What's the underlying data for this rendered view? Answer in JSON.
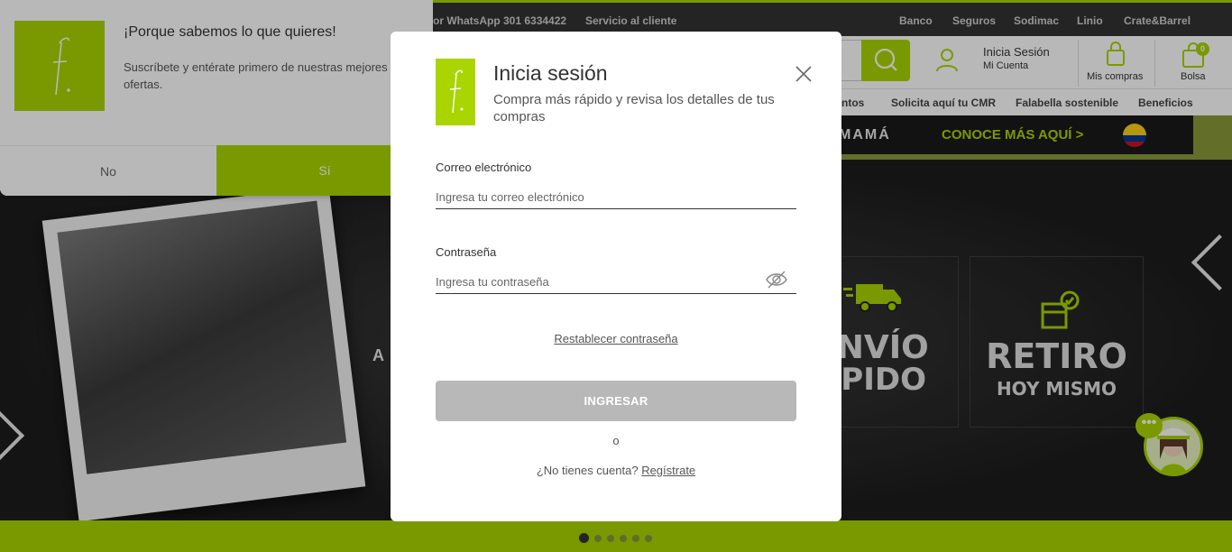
{
  "topbar": {
    "whatsapp": "or WhatsApp 301 6334422",
    "service": "Servicio al cliente",
    "links": [
      "Banco",
      "Seguros",
      "Sodimac",
      "Linio",
      "Crate&Barrel"
    ]
  },
  "header": {
    "login_title": "Inicia Sesión",
    "login_sub": "Mi Cuenta",
    "orders": "Mis compras",
    "bag": "Bolsa",
    "bag_count": "0"
  },
  "nav": [
    "ntos",
    "Solicita aquí tu CMR",
    "Falabella sostenible",
    "Beneficios"
  ],
  "promo": {
    "text1": "MAMÁ",
    "text2": "CONOCE MÁS AQUÍ >"
  },
  "hero": {
    "side_text": "A",
    "features": [
      {
        "line1": "ENVÍO",
        "line2": "ÁPIDO"
      },
      {
        "line1": "RETIRO",
        "line2": "HOY MISMO"
      }
    ]
  },
  "notification": {
    "title": "¡Porque sabemos lo que quieres!",
    "body": "Suscríbete y entérate primero de nuestras mejores ofertas.",
    "no": "No",
    "yes": "Sí"
  },
  "modal": {
    "title": "Inicia sesión",
    "subtitle": "Compra más rápido y revisa los detalles de tus compras",
    "email_label": "Correo electrónico",
    "email_placeholder": "Ingresa tu correo electrónico",
    "password_label": "Contraseña",
    "password_placeholder": "Ingresa tu contraseña",
    "reset": "Restablecer contraseña",
    "submit": "INGRESAR",
    "or": "o",
    "no_account": "¿No tienes cuenta?",
    "register": "Regístrate"
  },
  "colors": {
    "brand": "#aad500",
    "dark": "#333333",
    "disabled_button": "#b8b8b8"
  }
}
